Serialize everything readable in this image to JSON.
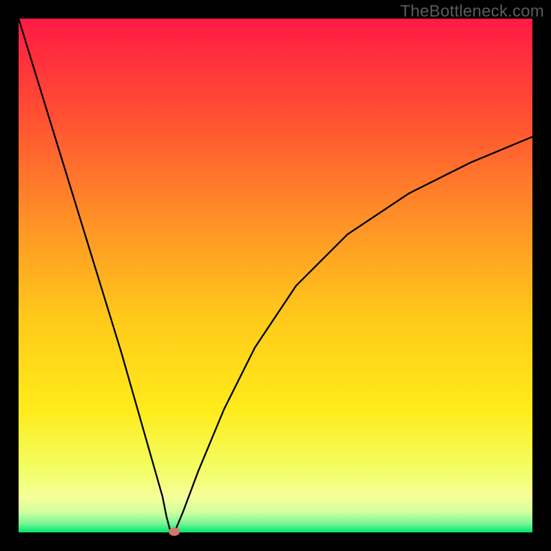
{
  "watermark": "TheBottleneck.com",
  "chart_data": {
    "type": "line",
    "title": "",
    "xlabel": "",
    "ylabel": "",
    "xlim": [
      0,
      100
    ],
    "ylim": [
      0,
      100
    ],
    "grid": false,
    "background_gradient": {
      "top": "#ff1a44",
      "mid": "#ffd11a",
      "bottom_band": "#f6ff99",
      "ground": "#00e66b"
    },
    "series": [
      {
        "name": "bottleneck-curve",
        "x": [
          0,
          4,
          8,
          12,
          16,
          20,
          24,
          26,
          28,
          28.8,
          29.5,
          30.5,
          32,
          35,
          40,
          46,
          54,
          64,
          76,
          88,
          100
        ],
        "y": [
          100,
          87,
          74,
          61,
          48,
          35,
          21,
          14,
          7,
          3,
          0.4,
          0.4,
          4,
          12,
          24,
          36,
          48,
          58,
          66,
          72,
          77
        ]
      }
    ],
    "marker": {
      "name": "current-point",
      "x": 30.3,
      "y": 0.2,
      "color": "#d6766e"
    }
  }
}
